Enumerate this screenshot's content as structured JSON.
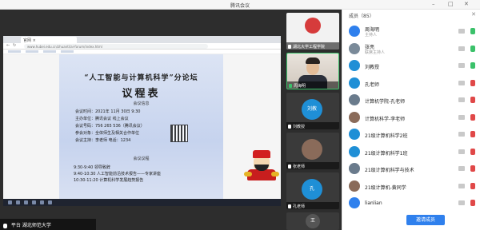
{
  "window": {
    "title": "腾讯会议"
  },
  "browser": {
    "tab_label": "官网 ×",
    "url": "www.hubei.edu.cn/zhuanti/ai-forum/index.html"
  },
  "poster": {
    "title": "“人工智能与计算机科学”分论坛",
    "subtitle": "议程表",
    "section1": "会议信息",
    "lines1": [
      "会议时间：2021年 11月 30日 9:30",
      "主办单位：腾讯会议 线上会议",
      "会议号码：756 265 536（腾讯会议）",
      "参会对象：全体师生及相关合作单位",
      "会议主持：李老师   电话：1234"
    ],
    "section2": "会议议程",
    "lines2": [
      "9:30-9:40  领导致辞",
      "9:40-10:30  人工智能前沿技术报告——专家讲座",
      "10:30-11:20  计算机科学发展趋势报告"
    ]
  },
  "presenter": {
    "name": "平台 湖北师范大学"
  },
  "tiles": [
    {
      "label": "湖北大学工程学院",
      "kind": "logo",
      "color": "#d63b3b"
    },
    {
      "label": "周海明",
      "kind": "person",
      "active": true
    },
    {
      "label": "刘教授",
      "kind": "circle",
      "initials": "刘教",
      "color": "#1f8fd6"
    },
    {
      "label": "张老师",
      "kind": "photo",
      "color": "#8a6b5a"
    },
    {
      "label": "孔老师",
      "kind": "circle",
      "initials": "孔",
      "color": "#1f8fd6"
    },
    {
      "label": "计算机科学系主任",
      "kind": "photo",
      "color": "#6a7b8c"
    },
    {
      "label": "王浩",
      "kind": "circle",
      "initials": "王",
      "color": "#555"
    }
  ],
  "panel": {
    "title": "成员（85）",
    "members": [
      {
        "name": "周海明",
        "sub": "主持人",
        "color": "#2f80ed",
        "mic_on": true
      },
      {
        "name": "张亮",
        "sub": "联席主持人",
        "color": "#7a8a99",
        "mic_on": true
      },
      {
        "name": "刘教授",
        "sub": "",
        "color": "#1f8fd6",
        "mic_on": true
      },
      {
        "name": "孔老师",
        "sub": "",
        "color": "#1f8fd6",
        "mic_on": false
      },
      {
        "name": "计算机学院-孔老师",
        "sub": "",
        "color": "#6a7b8c",
        "mic_on": false
      },
      {
        "name": "计算机科学-李老师",
        "sub": "",
        "color": "#8a6b5a",
        "mic_on": false
      },
      {
        "name": "21级计算机科学2班",
        "sub": "",
        "color": "#1f8fd6",
        "mic_on": false
      },
      {
        "name": "21级计算机科学1班",
        "sub": "",
        "color": "#1f8fd6",
        "mic_on": false
      },
      {
        "name": "21级计算机科学与技术",
        "sub": "",
        "color": "#6a7b8c",
        "mic_on": false
      },
      {
        "name": "21级计算机-黄同学",
        "sub": "",
        "color": "#8a6b5a",
        "mic_on": false
      },
      {
        "name": "lianlian",
        "sub": "",
        "color": "#2f80ed",
        "mic_on": false
      }
    ],
    "invite_label": "邀请成员"
  },
  "colors": {
    "accent": "#2f80ed",
    "mic_on": "#3bc16a",
    "mic_off": "#e04848"
  }
}
